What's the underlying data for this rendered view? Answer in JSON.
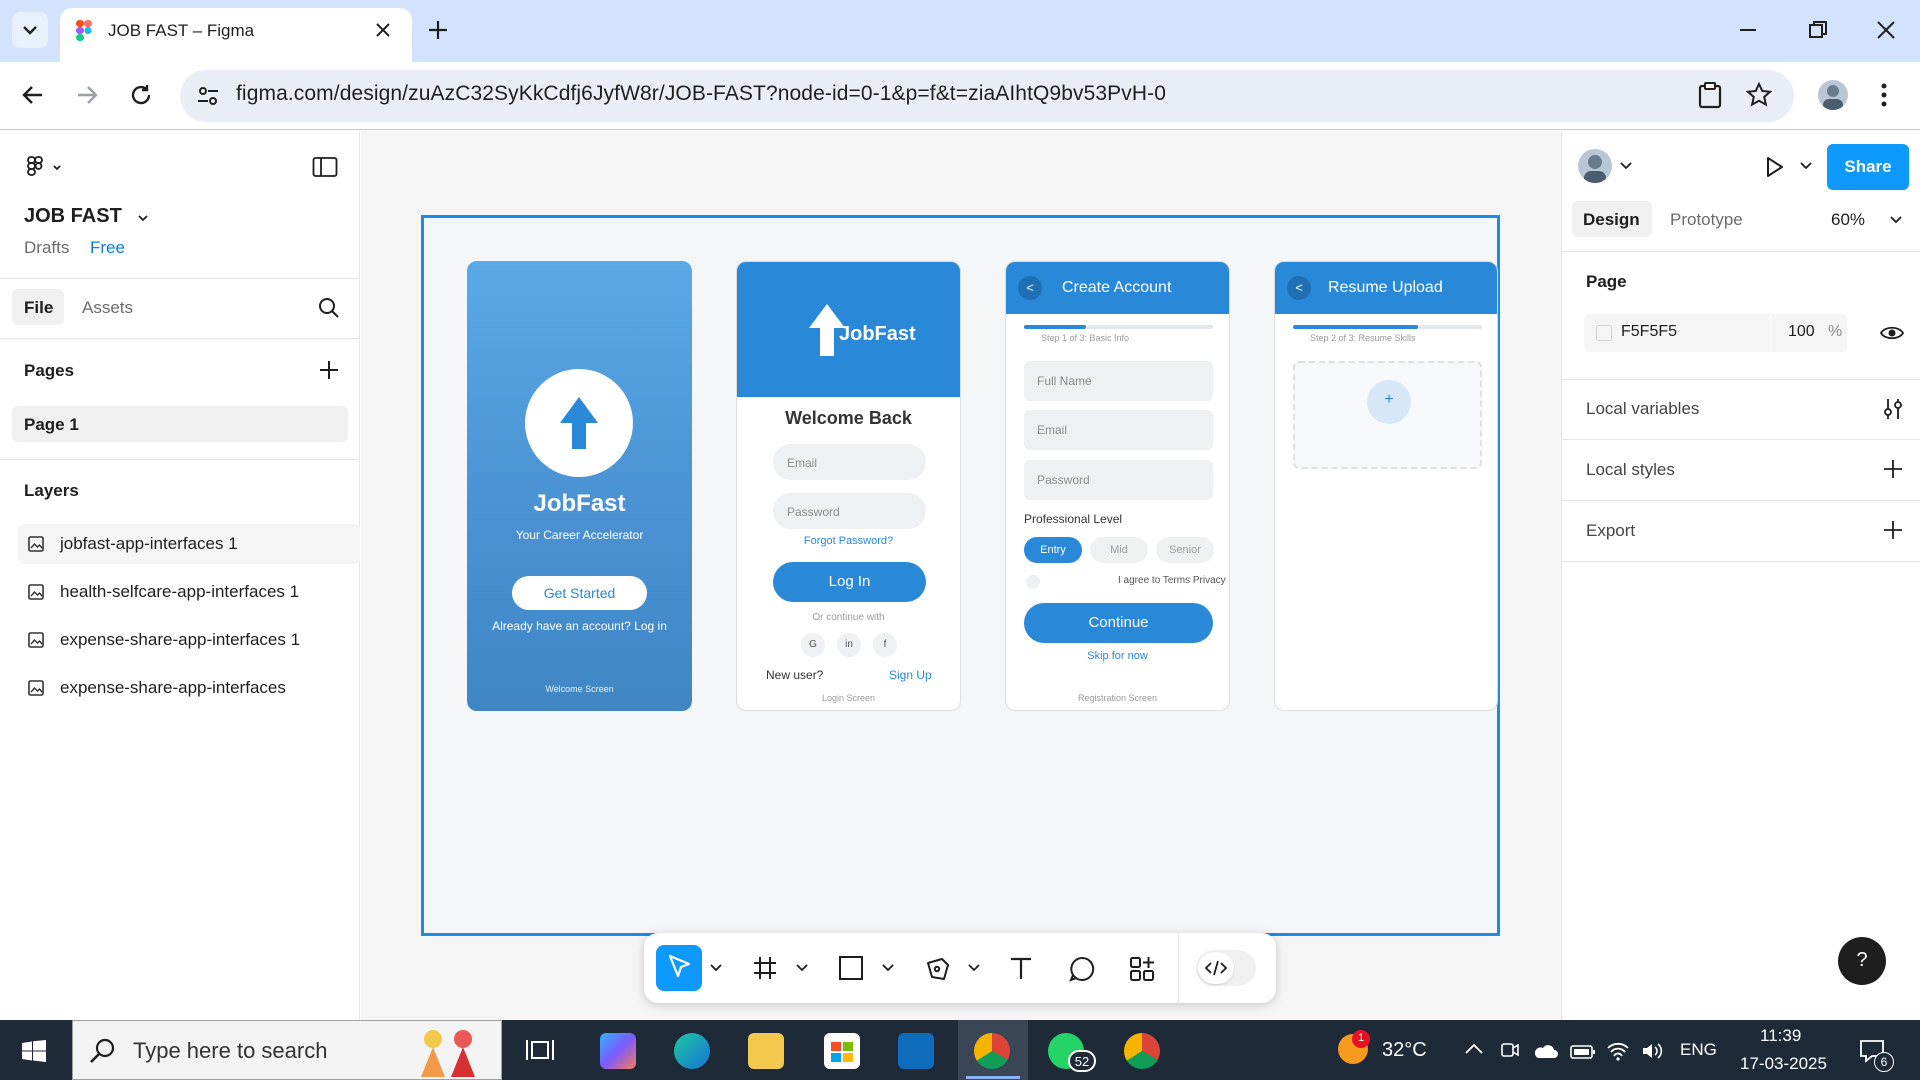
{
  "browser": {
    "tab_title": "JOB FAST – Figma",
    "url": "figma.com/design/zuAzC32SyKkCdfj6JyfW8r/JOB-FAST?node-id=0-1&p=f&t=ziaAIhtQ9bv53PvH-0"
  },
  "figma": {
    "file_name": "JOB FAST",
    "location": "Drafts",
    "plan": "Free",
    "tabs": {
      "file": "File",
      "assets": "Assets"
    },
    "pages_heading": "Pages",
    "pages": [
      "Page 1"
    ],
    "layers_heading": "Layers",
    "layers": [
      "jobfast-app-interfaces 1",
      "health-selfcare-app-interfaces 1",
      "expense-share-app-interfaces 1",
      "expense-share-app-interfaces"
    ],
    "right_panel": {
      "share": "Share",
      "tab_design": "Design",
      "tab_prototype": "Prototype",
      "zoom": "60%",
      "page_heading": "Page",
      "page_color": "F5F5F5",
      "page_opacity": "100",
      "percent": "%",
      "local_variables": "Local variables",
      "local_styles": "Local styles",
      "export": "Export"
    },
    "help": "?"
  },
  "mockup": {
    "welcome": {
      "brand": "JobFast",
      "tagline": "Your Career Accelerator",
      "cta": "Get Started",
      "login_hint": "Already have an account? Log in",
      "caption": "Welcome Screen"
    },
    "login": {
      "brand": "JobFast",
      "heading": "Welcome Back",
      "email_ph": "Email",
      "password_ph": "Password",
      "forgot": "Forgot Password?",
      "login_btn": "Log In",
      "or": "Or continue with",
      "social": [
        "G",
        "in",
        "f"
      ],
      "new_user": "New user?",
      "signup": "Sign Up",
      "caption": "Login Screen"
    },
    "register": {
      "back": "<",
      "title": "Create Account",
      "step": "Step 1 of 3: Basic Info",
      "progress": 0.33,
      "fields": [
        "Full Name",
        "Email",
        "Password"
      ],
      "level_label": "Professional Level",
      "levels": [
        "Entry",
        "Mid",
        "Senior"
      ],
      "agree": "I agree to Terms Privacy Policy",
      "continue_btn": "Continue",
      "skip": "Skip for now",
      "caption": "Registration Screen"
    },
    "resume": {
      "back": "<",
      "title": "Resume Upload",
      "step": "Step 2 of 3: Resume Skills",
      "progress": 0.66,
      "plus": "+"
    }
  },
  "taskbar": {
    "search_placeholder": "Type here to search",
    "weather": "32°C",
    "weather_badge": "1",
    "lang": "ENG",
    "time": "11:39",
    "date": "17-03-2025",
    "whatsapp_badge": "52",
    "notification_count": "6"
  },
  "colors": {
    "accent": "#2a88d8",
    "selection": "#1b8ce6",
    "share": "#0d99ff"
  }
}
